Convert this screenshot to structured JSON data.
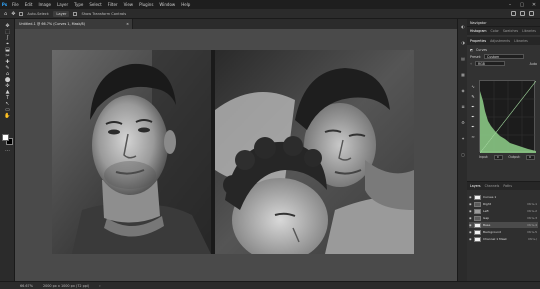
{
  "menubar": {
    "logo": "Ps",
    "items": [
      "File",
      "Edit",
      "Image",
      "Layer",
      "Type",
      "Select",
      "Filter",
      "View",
      "Plugins",
      "Window",
      "Help"
    ],
    "window_controls": [
      "–",
      "▢",
      "✕"
    ]
  },
  "options_bar": {
    "auto_select_label": "Auto-Select:",
    "auto_select_value": "Layer",
    "transform_label": "Show Transform Controls"
  },
  "document_tab": {
    "title": "Untitled-1 @ 66.7% (Curves 1, Mask/8)",
    "close": "×"
  },
  "status_bar": {
    "zoom": "66.67%",
    "doc_info": "2000 px x 1000 px (72 ppi)",
    "arrow": "›"
  },
  "panels": {
    "top_tabs": [
      "Navigator"
    ],
    "sub_tabs": [
      "Histogram",
      "Color",
      "Swatches",
      "Libraries"
    ],
    "props_tabs": [
      "Properties",
      "Adjustments",
      "Libraries"
    ],
    "curves_title": "Curves",
    "preset_label": "Preset:",
    "preset_value": "Custom",
    "channel_value": "RGB",
    "auto_label": "Auto",
    "input_label": "Input:",
    "input_value": "0",
    "output_label": "Output:",
    "output_value": "0",
    "layers_tabs": [
      "Layers",
      "Channels",
      "Paths"
    ],
    "layers": [
      {
        "name": "Curves 1",
        "shortcut": "",
        "thumb": "white"
      },
      {
        "name": "Right",
        "shortcut": "Ctrl+1",
        "thumb": "dark"
      },
      {
        "name": "Left",
        "shortcut": "Ctrl+2",
        "thumb": "gray"
      },
      {
        "name": "Gap",
        "shortcut": "Ctrl+3",
        "thumb": "dark"
      },
      {
        "name": "Base",
        "shortcut": "Ctrl+4",
        "thumb": "white"
      },
      {
        "name": "Background",
        "shortcut": "Ctrl+5",
        "thumb": "white"
      },
      {
        "name": "Channel 1 Mask",
        "shortcut": "Ctrl+\\",
        "thumb": "white"
      }
    ]
  },
  "tools": [
    "✥",
    "⬚",
    "ʃ",
    "⌖",
    "⬓",
    "✂",
    "✚",
    "✎",
    "⌂",
    "⬤",
    "✜",
    "▲",
    "T",
    "↖",
    "▭",
    "✋",
    "⌕",
    "…"
  ],
  "dock_icons": [
    "◐",
    "◑",
    "▤",
    "▦",
    "◈",
    "≣",
    "⚙",
    "✦",
    "◻"
  ],
  "colors": {
    "accent": "#31a8ff",
    "curve_green": "#8fd08a",
    "chrome_dark": "#1e1e1e",
    "panel_bg": "#323232",
    "canvas_bg": "#4a4a4a"
  }
}
